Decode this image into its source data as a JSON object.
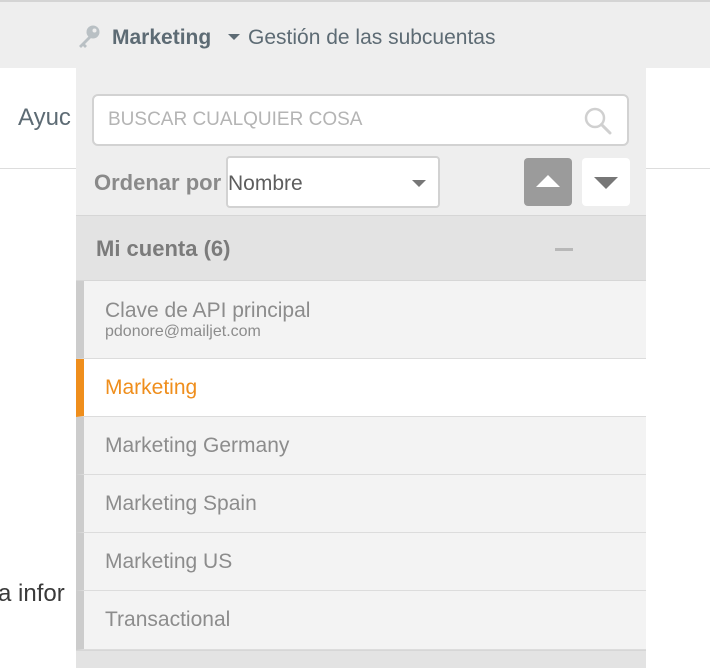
{
  "topbar": {
    "account_name": "Marketing",
    "subaccounts_link": "Gestión de las subcuentas"
  },
  "background": {
    "tab_text": "Ayuc",
    "body_text": "a infor"
  },
  "panel": {
    "search": {
      "placeholder": "BUSCAR CUALQUIER COSA",
      "value": ""
    },
    "sort": {
      "label": "Ordenar por",
      "selected": "Nombre"
    },
    "group": {
      "title": "Mi cuenta (6)"
    },
    "items": [
      {
        "name": "Clave de API principal",
        "email": "pdonore@mailjet.com",
        "active": false
      },
      {
        "name": "Marketing",
        "active": true
      },
      {
        "name": "Marketing Germany",
        "active": false
      },
      {
        "name": "Marketing Spain",
        "active": false
      },
      {
        "name": "Marketing US",
        "active": false
      },
      {
        "name": "Transactional",
        "active": false
      }
    ]
  },
  "colors": {
    "accent": "#ef8e1c",
    "text_muted": "#8c8c8c",
    "header_text": "#5d6b74"
  },
  "icons": {
    "account": "key-icon",
    "search": "search-icon",
    "sort_ascending": "triangle-up-icon",
    "sort_descending": "triangle-down-icon",
    "collapse": "minus-icon"
  }
}
